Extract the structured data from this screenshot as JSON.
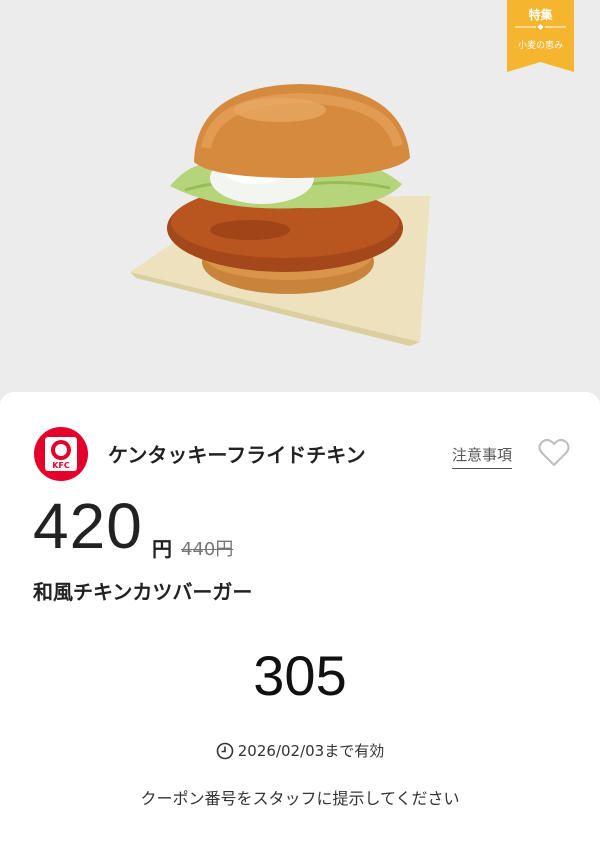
{
  "banner": {
    "badge_top": "特集",
    "badge_bottom": "小麦の恵み",
    "badge_color": "#f5b52e"
  },
  "store": {
    "name": "ケンタッキーフライドチキン",
    "logo_text": "KFC",
    "logo_color": "#e4002b"
  },
  "notes_link": "注意事項",
  "favorite_icon": "heart-outline-icon",
  "price": {
    "current": "420",
    "unit": "円",
    "original": "440円"
  },
  "product": {
    "name": "和風チキンカツバーガー"
  },
  "coupon": {
    "code": "305",
    "validity": "2026/02/03まで有効",
    "instruction": "クーポン番号をスタッフに提示してください"
  }
}
